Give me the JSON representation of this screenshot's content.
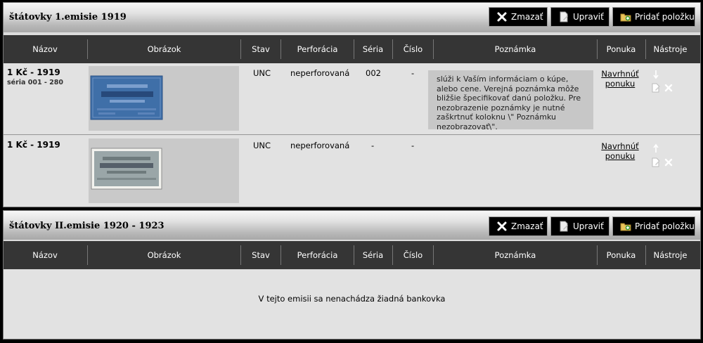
{
  "buttons": {
    "delete": "Zmazať",
    "edit": "Upraviť",
    "add": "Pridať položku"
  },
  "columns": [
    "Názov",
    "Obrázok",
    "Stav",
    "Perforácia",
    "Séria",
    "Číslo",
    "Poznámka",
    "Ponuka",
    "Nástroje"
  ],
  "sections": [
    {
      "title": "štátovky 1.emisie 1919",
      "rows": [
        {
          "name": "1 Kč - 1919",
          "subtitle": "séria 001 - 280",
          "image": "blue-banknote-image",
          "stav": "UNC",
          "perforacia": "neperforovaná",
          "seria": "002",
          "cislo": "-",
          "poznamka": "slúži k Vaším informáciam o kúpe, alebo cene. Verejná poznámka môže bližšie špecifikovať danú položku. Pre nezobrazenie poznámky je nutné zaškrtnuť koloknu \\\" Poznámku nezobrazovať\\\".",
          "ponuka": "Navrhnúť ponuku"
        },
        {
          "name": "1 Kč - 1919",
          "subtitle": "",
          "image": "grey-banknote-image",
          "stav": "UNC",
          "perforacia": "neperforovaná",
          "seria": "-",
          "cislo": "-",
          "poznamka": "",
          "ponuka": "Navrhnúť ponuku"
        }
      ]
    },
    {
      "title": "štátovky II.emisie 1920 - 1923",
      "empty_message": "V tejto emisii sa nenachádza žiadná bankovka"
    }
  ],
  "colors": {
    "header_bar": "#353535",
    "row_bg": "#e2e2e2",
    "note_bg": "#c7c7c7",
    "banknote_blue": "#3f6fa8",
    "banknote_grey": "#9aa6a8"
  },
  "icons": [
    "delete-icon",
    "edit-icon",
    "add-item-icon",
    "move-down-icon",
    "move-up-icon",
    "edit-row-icon",
    "delete-row-icon"
  ]
}
